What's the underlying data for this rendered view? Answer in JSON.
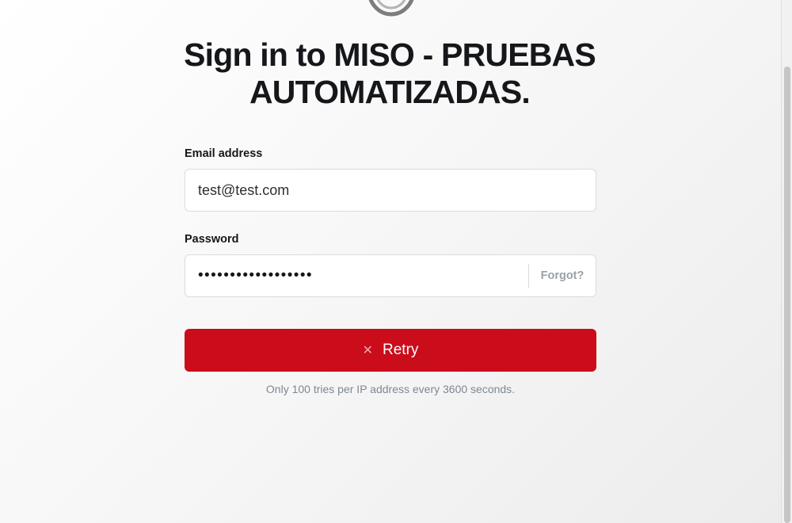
{
  "page": {
    "title": "Sign in to MISO - PRUEBAS AUTOMATIZADAS."
  },
  "form": {
    "email_label": "Email address",
    "email_value": "test@test.com",
    "password_label": "Password",
    "password_value": "••••••••••••••••••",
    "forgot_label": "Forgot?",
    "submit_label": "Retry",
    "submit_icon": "x-icon",
    "rate_limit_note": "Only 100 tries per IP address every 3600 seconds."
  },
  "colors": {
    "primary": "#cb0c1b",
    "text": "#15171a",
    "muted": "#7f8891"
  }
}
